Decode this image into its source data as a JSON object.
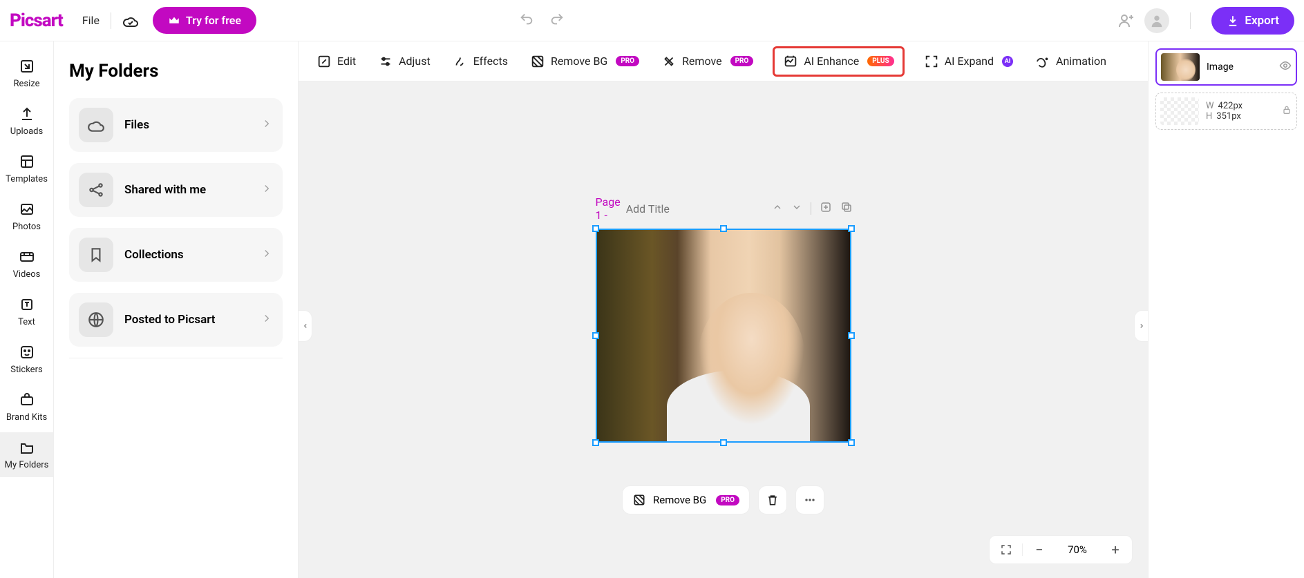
{
  "header": {
    "logo": "Picsart",
    "file_menu": "File",
    "try_free": "Try for free",
    "export": "Export"
  },
  "sidenav": [
    {
      "label": "Resize"
    },
    {
      "label": "Uploads"
    },
    {
      "label": "Templates"
    },
    {
      "label": "Photos"
    },
    {
      "label": "Videos"
    },
    {
      "label": "Text"
    },
    {
      "label": "Stickers"
    },
    {
      "label": "Brand Kits"
    },
    {
      "label": "My Folders"
    }
  ],
  "folders": {
    "title": "My Folders",
    "items": [
      {
        "label": "Files"
      },
      {
        "label": "Shared with me"
      },
      {
        "label": "Collections"
      },
      {
        "label": "Posted to Picsart"
      }
    ]
  },
  "toolbar": {
    "edit": "Edit",
    "adjust": "Adjust",
    "effects": "Effects",
    "remove_bg": "Remove BG",
    "remove": "Remove",
    "ai_enhance": "AI Enhance",
    "ai_expand": "AI Expand",
    "animation": "Animation",
    "badge_pro": "PRO",
    "badge_plus": "PLUS",
    "badge_ai": "AI"
  },
  "canvas": {
    "page_label": "Page 1 -",
    "title_placeholder": "Add Title",
    "float_remove_bg": "Remove BG",
    "float_badge": "PRO",
    "zoom": "70%"
  },
  "layers": {
    "image_label": "Image",
    "w_key": "W",
    "w_val": "422px",
    "h_key": "H",
    "h_val": "351px"
  }
}
